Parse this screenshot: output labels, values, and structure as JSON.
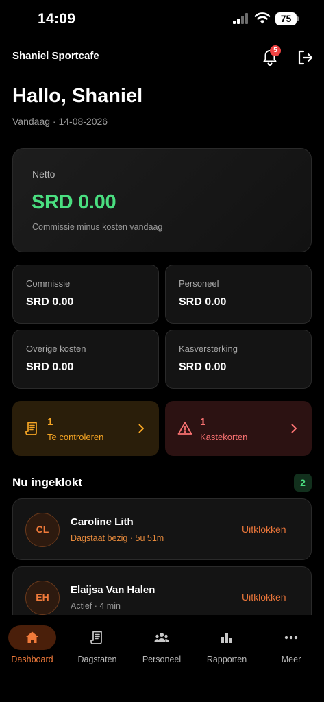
{
  "status_bar": {
    "time": "14:09",
    "battery": "75"
  },
  "header": {
    "app_title": "Shaniel Sportcafe",
    "notification_count": "5"
  },
  "greeting": "Hallo, Shaniel",
  "date_line": "Vandaag · 14-08-2026",
  "netto": {
    "label": "Netto",
    "value": "SRD 0.00",
    "subtitle": "Commissie minus kosten vandaag",
    "color": "#4ade80"
  },
  "stats": [
    {
      "label": "Commissie",
      "value": "SRD 0.00"
    },
    {
      "label": "Personeel",
      "value": "SRD 0.00"
    },
    {
      "label": "Overige kosten",
      "value": "SRD 0.00"
    },
    {
      "label": "Kasversterking",
      "value": "SRD 0.00"
    }
  ],
  "alerts": [
    {
      "count": "1",
      "label": "Te controleren",
      "icon": "receipt-icon",
      "color": "#f5a524"
    },
    {
      "count": "1",
      "label": "Kastekorten",
      "icon": "warning-icon",
      "color": "#f87171"
    }
  ],
  "clocked_in": {
    "title": "Nu ingeklokt",
    "count": "2",
    "people": [
      {
        "initials": "CL",
        "name": "Caroline Lith",
        "status": "Dagstaat bezig · 5u 51m",
        "action": "Uitklokken"
      },
      {
        "initials": "EH",
        "name": "Elaijsa Van Halen",
        "status": "Actief · 4 min",
        "action": "Uitklokken"
      }
    ]
  },
  "nav": [
    {
      "label": "Dashboard",
      "icon": "home-icon",
      "active": true
    },
    {
      "label": "Dagstaten",
      "icon": "document-icon"
    },
    {
      "label": "Personeel",
      "icon": "people-icon"
    },
    {
      "label": "Rapporten",
      "icon": "bar-chart-icon"
    },
    {
      "label": "Meer",
      "icon": "more-icon"
    }
  ],
  "accent_color": "#f07a3a"
}
